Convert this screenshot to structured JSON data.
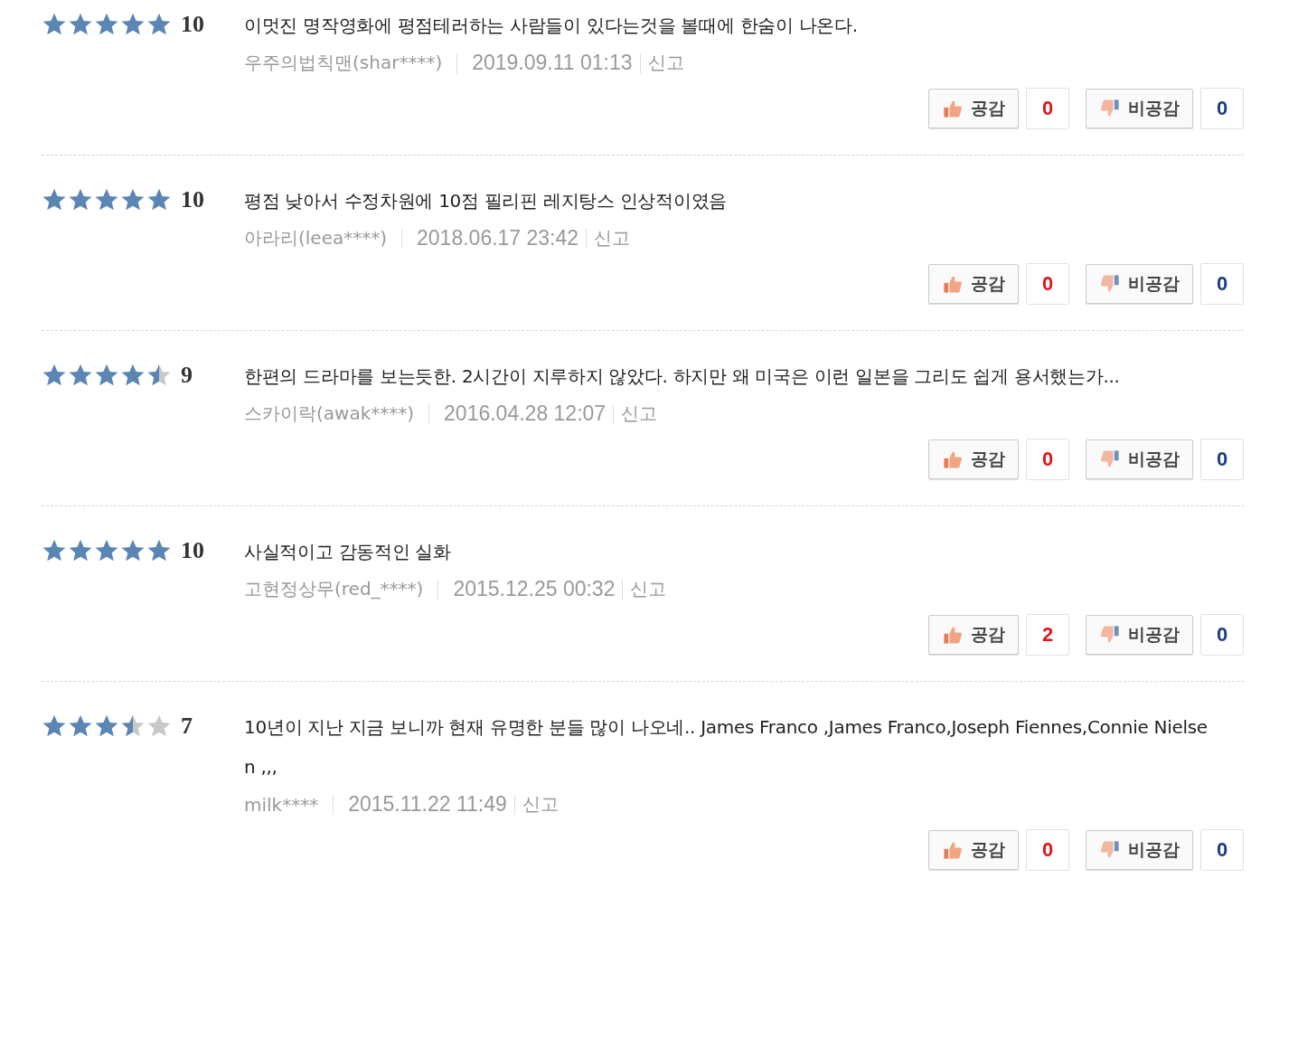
{
  "reviews": [
    {
      "stars": 5,
      "score": "10",
      "text": "이멋진 명작영화에 평점테러하는 사람들이 있다는것을 볼때에 한숨이 나온다.",
      "author": "우주의법칙맨(shar****)",
      "date": "2019.09.11 01:13",
      "report": "신고",
      "like_label": "공감",
      "like_count": "0",
      "dislike_label": "비공감",
      "dislike_count": "0"
    },
    {
      "stars": 5,
      "score": "10",
      "text": "평점 낮아서 수정차원에 10점 필리핀 레지탕스 인상적이였음",
      "author": "아라리(leea****)",
      "date": "2018.06.17 23:42",
      "report": "신고",
      "like_label": "공감",
      "like_count": "0",
      "dislike_label": "비공감",
      "dislike_count": "0"
    },
    {
      "stars": 4.5,
      "score": "9",
      "text": "한편의 드라마를 보는듯한. 2시간이 지루하지 않았다. 하지만 왜 미국은 이런 일본을 그리도 쉽게 용서했는가...",
      "author": "스카이락(awak****)",
      "date": "2016.04.28 12:07",
      "report": "신고",
      "like_label": "공감",
      "like_count": "0",
      "dislike_label": "비공감",
      "dislike_count": "0"
    },
    {
      "stars": 5,
      "score": "10",
      "text": "사실적이고 감동적인 실화",
      "author": "고현정상무(red_****)",
      "date": "2015.12.25 00:32",
      "report": "신고",
      "like_label": "공감",
      "like_count": "2",
      "dislike_label": "비공감",
      "dislike_count": "0"
    },
    {
      "stars": 3.5,
      "score": "7",
      "text": "10년이 지난 지금 보니까 현재 유명한 분들 많이 나오네.. James Franco ,James Franco,Joseph Fiennes,Connie Nielsen ,,,",
      "author": "milk****",
      "date": "2015.11.22 11:49",
      "report": "신고",
      "like_label": "공감",
      "like_count": "0",
      "dislike_label": "비공감",
      "dislike_count": "0"
    }
  ]
}
